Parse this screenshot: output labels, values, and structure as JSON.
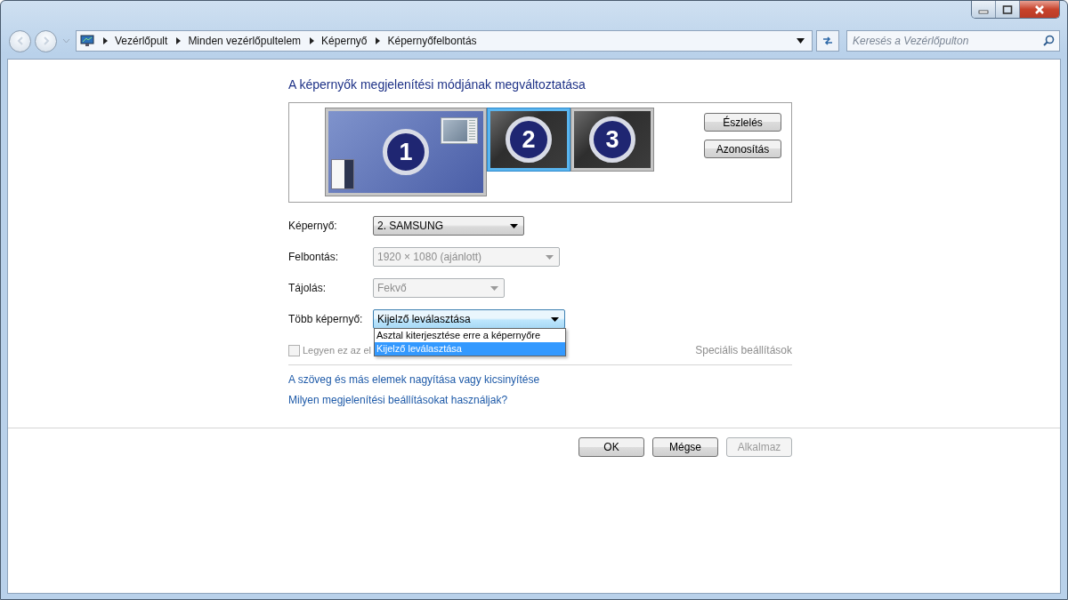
{
  "address_bar": {
    "breadcrumbs": [
      "Vezérlőpult",
      "Minden vezérlőpultelem",
      "Képernyő",
      "Képernyőfelbontás"
    ]
  },
  "search": {
    "placeholder": "Keresés a Vezérlőpulton"
  },
  "heading": "A képernyők megjelenítési módjának megváltoztatása",
  "monitors": [
    {
      "number": "1",
      "primary": true,
      "selected": false
    },
    {
      "number": "2",
      "primary": false,
      "selected": true
    },
    {
      "number": "3",
      "primary": false,
      "selected": false
    }
  ],
  "arrangement_buttons": [
    "Észlelés",
    "Azonosítás"
  ],
  "settings": [
    {
      "label": "Képernyő:",
      "value": "2. SAMSUNG",
      "disabled": false,
      "expanded": false
    },
    {
      "label": "Felbontás:",
      "value": "1920 × 1080 (ajánlott)",
      "disabled": true,
      "expanded": false
    },
    {
      "label": "Tájolás:",
      "value": "Fekvő",
      "disabled": true,
      "expanded": false
    },
    {
      "label": "Több képernyő:",
      "value": "Kijelző leválasztása",
      "disabled": false,
      "expanded": true
    }
  ],
  "dropdown_options": [
    {
      "label": "Asztal kiterjesztése erre a képernyőre",
      "selected": false
    },
    {
      "label": "Kijelző leválasztása",
      "selected": true
    }
  ],
  "checkbox": {
    "label": "Legyen ez az el",
    "checked": false,
    "disabled": true
  },
  "advanced_link": {
    "label": "Speciális beállítások",
    "disabled": true
  },
  "links": [
    "A szöveg és más elemek nagyítása vagy kicsinyítése",
    "Milyen megjelenítési beállításokat használjak?"
  ],
  "buttons": [
    {
      "label": "OK",
      "disabled": false
    },
    {
      "label": "Mégse",
      "disabled": false
    },
    {
      "label": "Alkalmaz",
      "disabled": true
    }
  ]
}
